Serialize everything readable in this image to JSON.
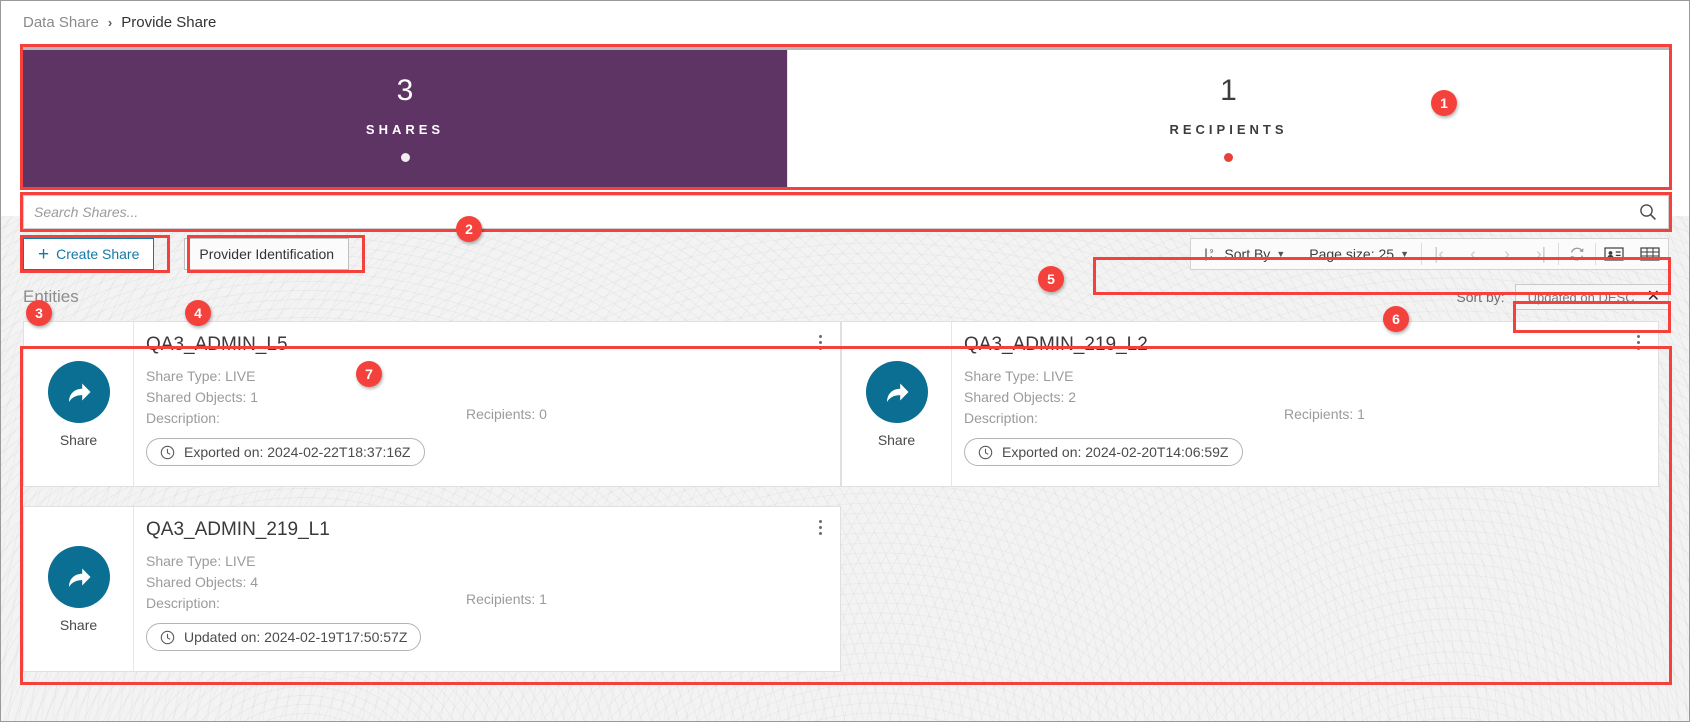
{
  "breadcrumb": {
    "root": "Data Share",
    "separator": "›",
    "current": "Provide Share"
  },
  "kpis": [
    {
      "value": "3",
      "label": "SHARES",
      "dot_color": "#f0eef1"
    },
    {
      "value": "1",
      "label": "RECIPIENTS",
      "dot_color": "#e8403a"
    }
  ],
  "search": {
    "placeholder": "Search Shares...",
    "value": "",
    "icon": "search-icon"
  },
  "actions": {
    "create_share": "Create Share",
    "create_share_plus": "+",
    "provider_identification": "Provider Identification"
  },
  "toolbar": {
    "sort_by": "Sort By",
    "page_size": "Page size: 25",
    "caret": "▼",
    "pager": {
      "first": "|‹",
      "prev": "‹",
      "next": "›",
      "last": "›|"
    },
    "refresh_icon": "refresh-icon",
    "card_view_icon": "card-view-icon",
    "table_view_icon": "table-view-icon"
  },
  "entities": {
    "title": "Entities",
    "sort_by_label": "Sort by:",
    "sort_chip": "Updated on DESC",
    "sort_chip_clear": "✕"
  },
  "cards": [
    {
      "title": "QA3_ADMIN_L5",
      "share_caption": "Share",
      "share_type": "Share Type: LIVE",
      "shared_objects": "Shared Objects: 1",
      "description": "Description:",
      "recipients": "Recipients: 0",
      "stamp": "Exported on: 2024-02-22T18:37:16Z",
      "stamp_icon": "clock-icon",
      "menu_icon": "kebab-menu-icon"
    },
    {
      "title": "QA3_ADMIN_219_L2",
      "share_caption": "Share",
      "share_type": "Share Type: LIVE",
      "shared_objects": "Shared Objects: 2",
      "description": "Description:",
      "recipients": "Recipients: 1",
      "stamp": "Exported on: 2024-02-20T14:06:59Z",
      "stamp_icon": "clock-icon",
      "menu_icon": "kebab-menu-icon"
    },
    {
      "title": "QA3_ADMIN_219_L1",
      "share_caption": "Share",
      "share_type": "Share Type: LIVE",
      "shared_objects": "Shared Objects: 4",
      "description": "Description:",
      "recipients": "Recipients: 1",
      "stamp": "Updated on: 2024-02-19T17:50:57Z",
      "stamp_icon": "clock-icon",
      "menu_icon": "kebab-menu-icon"
    }
  ],
  "annotations": [
    {
      "n": "1"
    },
    {
      "n": "2"
    },
    {
      "n": "3"
    },
    {
      "n": "4"
    },
    {
      "n": "5"
    },
    {
      "n": "6"
    },
    {
      "n": "7"
    }
  ],
  "colors": {
    "annotation": "#f5413c",
    "shares_tile": "#5d3463",
    "share_icon": "#0b6e93",
    "link": "#1179a8"
  }
}
